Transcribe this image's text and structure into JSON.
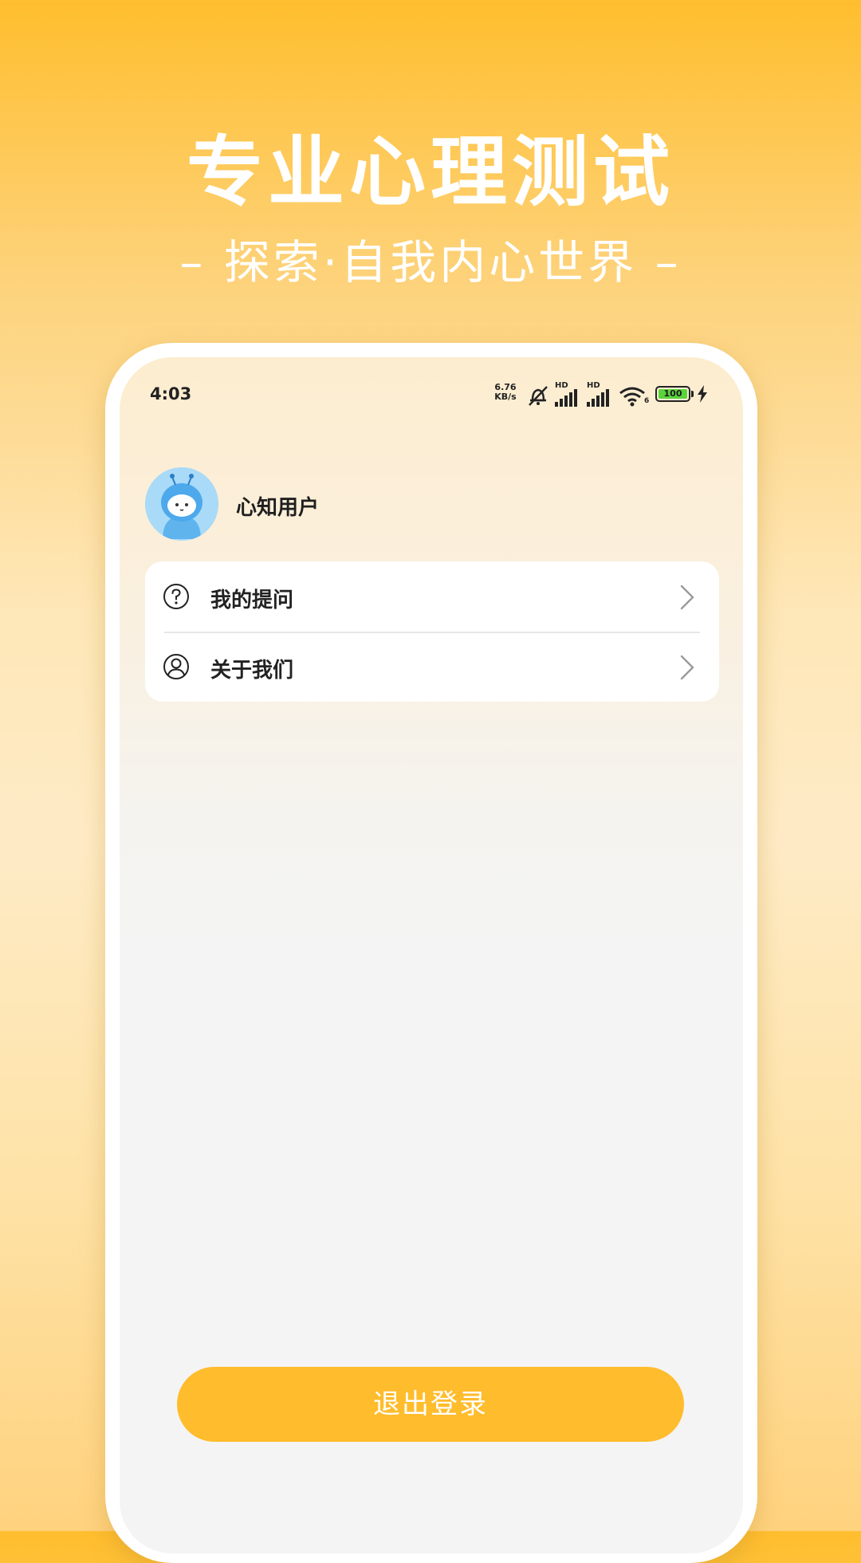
{
  "promo": {
    "title": "专业心理测试",
    "subtitle": "– 探索·自我内心世界 –"
  },
  "status_bar": {
    "time": "4:03",
    "net_speed_value": "6.76",
    "net_speed_unit": "KB/s",
    "signal_label_1": "HD",
    "signal_label_2": "HD",
    "wifi_label": "6",
    "battery_level": "100"
  },
  "profile": {
    "username": "心知用户"
  },
  "menu": {
    "items": [
      {
        "label": "我的提问",
        "icon": "question-circle-icon"
      },
      {
        "label": "关于我们",
        "icon": "user-circle-icon"
      }
    ]
  },
  "logout": {
    "label": "退出登录"
  },
  "colors": {
    "accent": "#FFBC2C",
    "battery": "#5AD33C"
  }
}
